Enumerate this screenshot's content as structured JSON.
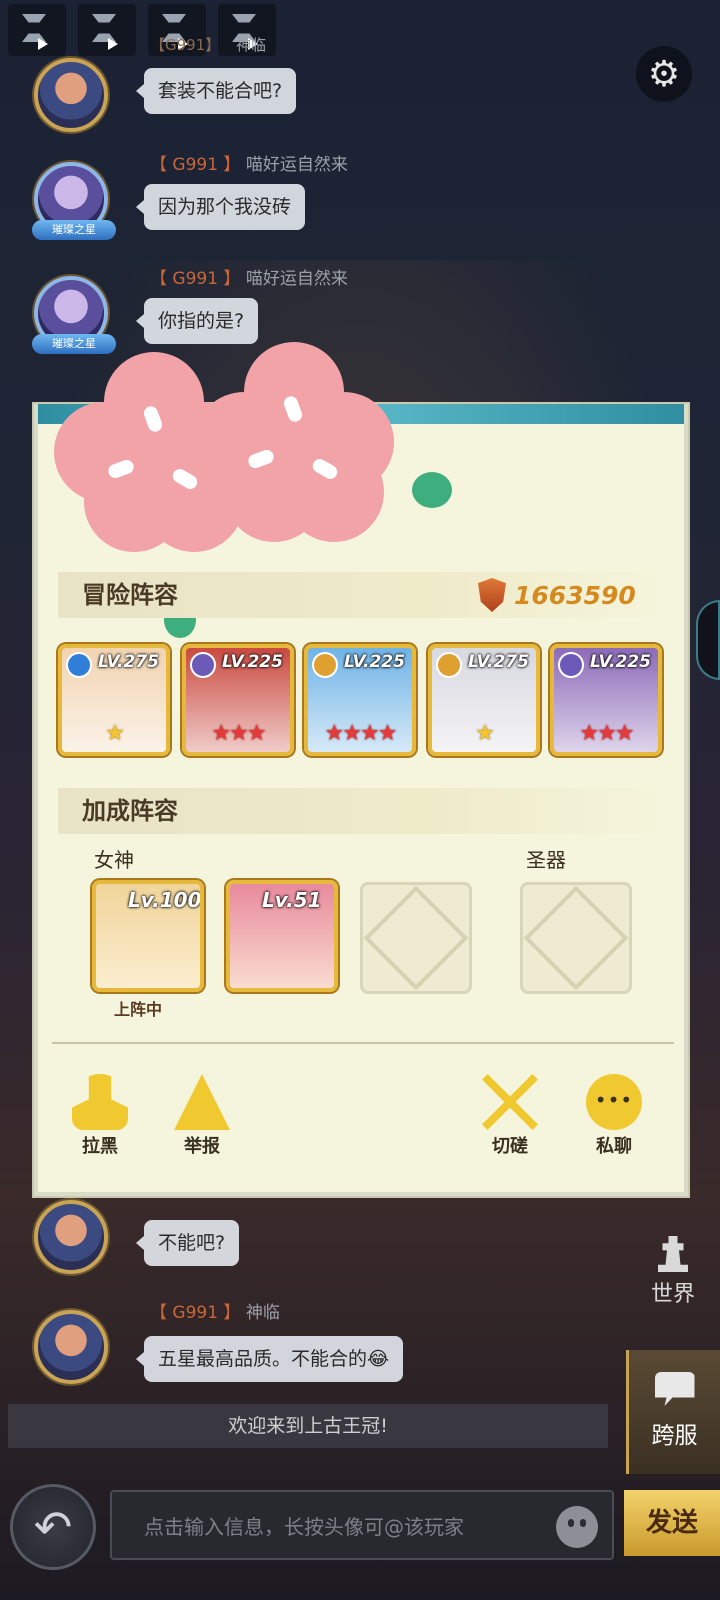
{
  "top_bar": {
    "voice_messages": [
      "voice-1",
      "voice-2",
      "voice-3",
      "voice-4"
    ],
    "cut_message_server": "【G991】",
    "cut_message_name": "神临"
  },
  "settings_icon": "gear-icon",
  "messages": [
    {
      "server": "",
      "name": "",
      "text": "套装不能合吧?"
    },
    {
      "server": "【 G991 】",
      "name": "喵好运自然来",
      "text": "因为那个我没砖",
      "avatar_tag": "璀璨之星"
    },
    {
      "server": "【 G991 】",
      "name": "喵好运自然来",
      "text": "你指的是?",
      "avatar_tag": "璀璨之星"
    },
    {
      "server": "",
      "name": "",
      "text": "不能吧?"
    },
    {
      "server": "【 G991 】",
      "name": "神临",
      "text": "五星最高品质。不能合的😂"
    }
  ],
  "player_panel": {
    "adventure_title": "冒险阵容",
    "power": "1663590",
    "heroes": [
      {
        "level": "LV.275",
        "stars": "★",
        "star_type": "gold",
        "badge_color": "#2f7fd8",
        "portrait": "#f1d3b0"
      },
      {
        "level": "LV.225",
        "stars": "★★★",
        "star_type": "red",
        "badge_color": "#6c5ab8",
        "portrait": "#c94a40"
      },
      {
        "level": "LV.225",
        "stars": "★★★★",
        "star_type": "red",
        "badge_color": "#e0a030",
        "portrait": "#6fb3e6"
      },
      {
        "level": "LV.275",
        "stars": "★",
        "star_type": "gold",
        "badge_color": "#e0a030",
        "portrait": "#d8d8e0"
      },
      {
        "level": "LV.225",
        "stars": "★★★",
        "star_type": "red",
        "badge_color": "#6c5ab8",
        "portrait": "#8c6ab8"
      }
    ],
    "bonus_title": "加成阵容",
    "goddess_label": "女神",
    "artifact_label": "圣器",
    "goddesses": [
      {
        "level": "Lv.100",
        "portrait": "#f0d49a"
      },
      {
        "level": "Lv.51",
        "portrait": "#e88a9c"
      }
    ],
    "on_team_label": "上阵中",
    "actions": {
      "block": "拉黑",
      "report": "举报",
      "duel": "切磋",
      "private_chat": "私聊"
    }
  },
  "side_tabs": {
    "world": "世界",
    "cross_server": "跨服"
  },
  "notice": "欢迎来到上古王冠!",
  "input": {
    "placeholder": "点击输入信息，长按头像可@该玩家",
    "send_label": "发送"
  },
  "colors": {
    "server_tag": "#c8663a",
    "panel_bg": "#f5f5dd",
    "power_text": "#d58a20",
    "send_button": "#f2d26a"
  }
}
